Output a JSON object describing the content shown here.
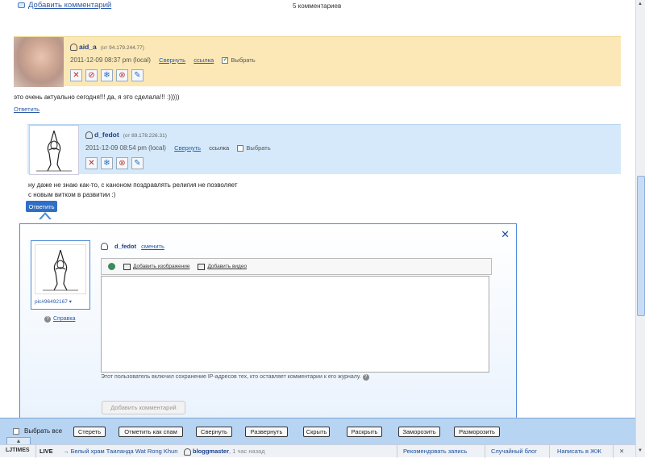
{
  "top": {
    "add_comment": "Добавить комментарий",
    "count": "5 комментариев"
  },
  "comment1": {
    "username": "aid_a",
    "ip": "(от 94.179.244.77)",
    "datetime": "2011-12-09 08:37 pm (local)",
    "collapse": "Свернуть",
    "link": "ссылка",
    "select": "Выбрать",
    "text": "это очень актуально сегодня!!! да, я это сделала!!! :)))))",
    "reply": "Ответить"
  },
  "comment2": {
    "username": "d_fedot",
    "ip": "(от 89.178.226.31)",
    "datetime": "2011-12-09 08:54 pm (local)",
    "collapse": "Свернуть",
    "link": "ссылка",
    "select": "Выбрать",
    "text_line1": "ну даже не знаю как-то, с каноном поздравлять религия не позволяет",
    "text_line2": "с новым витком в развитии :)",
    "reply": "Ответить"
  },
  "form": {
    "close": "✕",
    "pic": "pic#96492167",
    "help": "Справка",
    "username": "d_fedot",
    "change": "сменить",
    "add_image": "Добавить изображение",
    "add_video": "Добавить видео",
    "ip_note": "Этот пользователь включил сохранение IP-адресов тех, кто оставляет комментарии к его журналу.",
    "submit": "Добавить комментарий"
  },
  "actbar": {
    "select_all": "Выбрать все",
    "buttons": {
      "erase": "Стереть",
      "spam": "Отметить как спам",
      "collapse": "Свернуть",
      "expand": "Развернуть",
      "hide": "Скрыть",
      "unhide": "Раскрыть",
      "freeze": "Заморозить",
      "unfreeze": "Разморозить"
    }
  },
  "ljbar": {
    "logo": "LJTIMES",
    "live": "LIVE",
    "story": "→ Белый храм Таиланда Wat Rong Khun",
    "user": "bloggmaster",
    "ago": ", 1 час назад",
    "recommend": "Рекомендовать запись",
    "random": "Случайный блог",
    "write": "Написать в ЖЖ"
  }
}
